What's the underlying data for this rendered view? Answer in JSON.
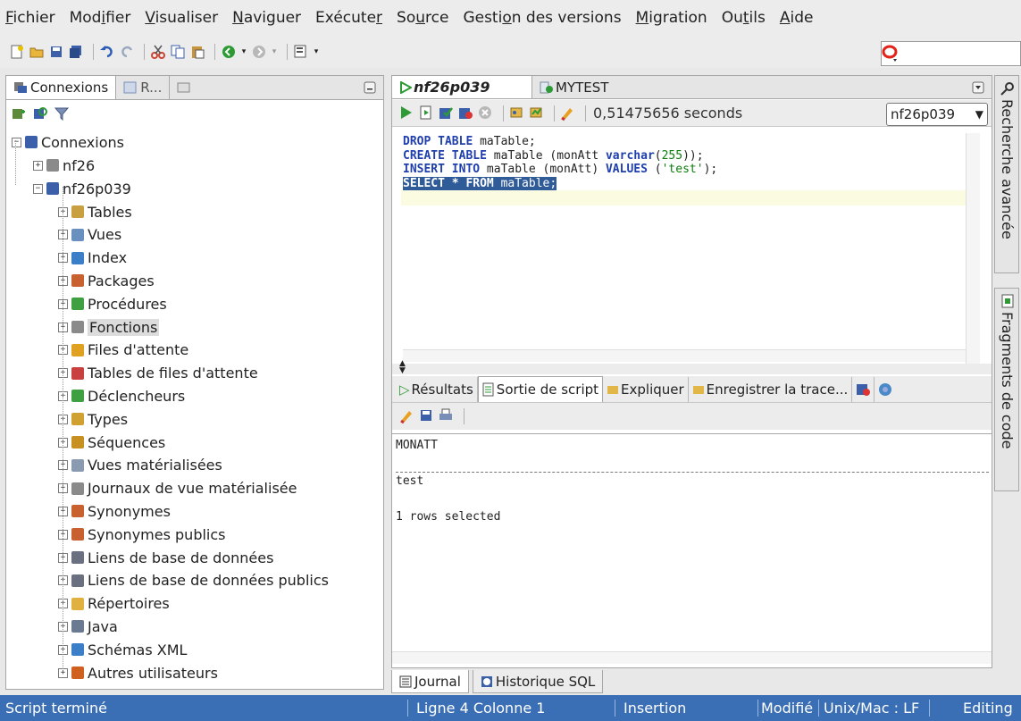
{
  "menu": [
    "Fichier",
    "Modifier",
    "Visualiser",
    "Naviguer",
    "Exécuter",
    "Source",
    "Gestion des versions",
    "Migration",
    "Outils",
    "Aide"
  ],
  "menu_underline": [
    "F",
    "i",
    "V",
    "N",
    "r",
    "u",
    "o",
    "M",
    "t",
    "A"
  ],
  "left_tabs": [
    "Connexions",
    "R..."
  ],
  "tree": {
    "root": "Connexions",
    "conn1": "nf26",
    "conn2": "nf26p039",
    "items": [
      "Tables",
      "Vues",
      "Index",
      "Packages",
      "Procédures",
      "Fonctions",
      "Files d'attente",
      "Tables de files d'attente",
      "Déclencheurs",
      "Types",
      "Séquences",
      "Vues matérialisées",
      "Journaux de vue matérialisée",
      "Synonymes",
      "Synonymes publics",
      "Liens de base de données",
      "Liens de base de données publics",
      "Répertoires",
      "Java",
      "Schémas XML",
      "Autres utilisateurs"
    ],
    "selected": "Fonctions"
  },
  "editor_tabs": [
    "nf26p039",
    "MYTEST"
  ],
  "exec_time": "0,51475656 seconds",
  "connection_select": "nf26p039",
  "code": {
    "l1": {
      "a": "DROP TABLE",
      "b": " maTable;"
    },
    "l2": {
      "a": "CREATE TABLE",
      "b": " maTable (monAtt ",
      "c": "varchar",
      "d": "(",
      "e": "255",
      "f": "));"
    },
    "l3": {
      "a": "INSERT INTO",
      "b": " maTable (monAtt) ",
      "c": "VALUES",
      "d": " (",
      "e": "'test'",
      "f": ");"
    },
    "l4": {
      "a": "SELECT * FROM",
      "b": " maTable;"
    }
  },
  "result_tabs": [
    "Résultats",
    "Sortie de script",
    "Expliquer",
    "Enregistrer la trace..."
  ],
  "output": {
    "header": "MONATT",
    "value": "test",
    "summary": "1 rows selected"
  },
  "bottom_tabs": [
    "Journal",
    "Historique SQL"
  ],
  "right_sidebar": [
    "Recherche avancée",
    "Fragments de code"
  ],
  "status": {
    "left": "Script terminé",
    "pos": "Ligne 4 Colonne 1",
    "mode": "Insertion",
    "modified": "Modifié",
    "eol": "Unix/Mac : LF",
    "edit": "Editing"
  },
  "colors": {
    "status_bar": "#3a6eb5",
    "selection": "#2f5b99",
    "keyword": "#1f3fae",
    "string": "#0b7d0b"
  }
}
